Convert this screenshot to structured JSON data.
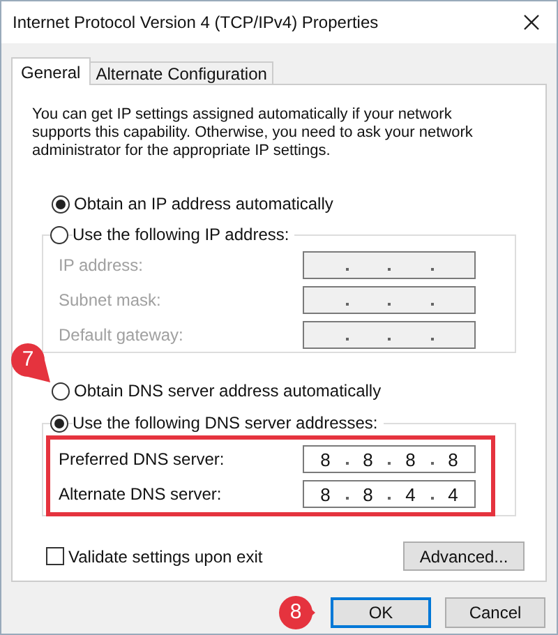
{
  "window": {
    "title": "Internet Protocol Version 4 (TCP/IPv4) Properties"
  },
  "tabs": [
    {
      "label": "General",
      "selected": true
    },
    {
      "label": "Alternate Configuration",
      "selected": false
    }
  ],
  "description": "You can get IP settings assigned automatically if your network supports this capability. Otherwise, you need to ask your network administrator for the appropriate IP settings.",
  "ip_options": [
    {
      "label": "Obtain an IP address automatically",
      "selected": true
    },
    {
      "label": "Use the following IP address:",
      "selected": false
    }
  ],
  "ip_fields": [
    {
      "label": "IP address:",
      "disabled": true
    },
    {
      "label": "Subnet mask:",
      "disabled": true
    },
    {
      "label": "Default gateway:",
      "disabled": true
    }
  ],
  "dns_options": [
    {
      "label": "Obtain DNS server address automatically",
      "selected": false
    },
    {
      "label": "Use the following DNS server addresses:",
      "selected": true
    }
  ],
  "dns_fields": [
    {
      "label": "Preferred DNS server:",
      "disabled": false,
      "octets": [
        "8",
        "8",
        "8",
        "8"
      ]
    },
    {
      "label": "Alternate DNS server:",
      "disabled": false,
      "octets": [
        "8",
        "8",
        "4",
        "4"
      ]
    }
  ],
  "validate": {
    "label": "Validate settings upon exit",
    "checked": false
  },
  "advanced_button": "Advanced...",
  "buttons": [
    {
      "label": "OK",
      "default": true
    },
    {
      "label": "Cancel",
      "default": false
    }
  ],
  "annotations": [
    {
      "label": "7"
    },
    {
      "label": "8"
    }
  ]
}
